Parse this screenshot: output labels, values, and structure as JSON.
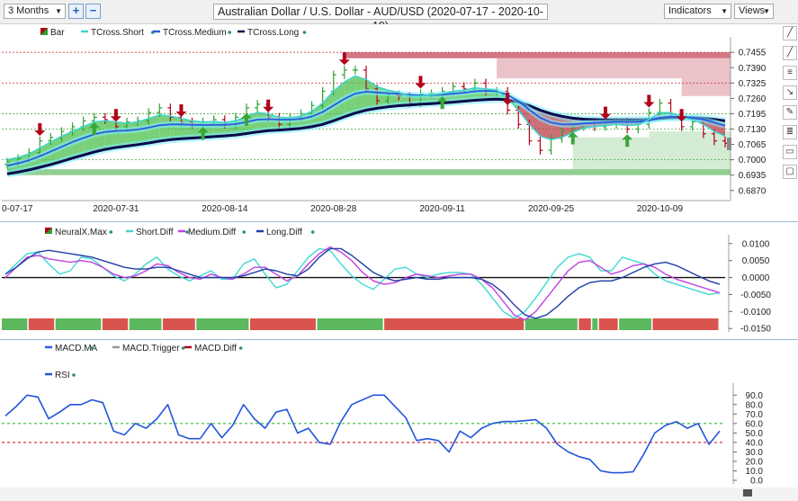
{
  "toolbar": {
    "period": "3 Months",
    "add_label": "+",
    "minus_label": "−",
    "title": "Australian Dollar / U.S. Dollar - AUD/USD (2020-07-17 - 2020-10-19)",
    "indicators_label": "Indicators",
    "views_label": "Views"
  },
  "colors": {
    "bull": "#2da12d",
    "bear": "#b3001b",
    "short": "#3fd6cf",
    "medium": "#2a5be0",
    "long": "#0b0b4a",
    "neural_green": "#5cb85c",
    "neural_red": "#d9534f",
    "magenta": "#c040e0",
    "rsi": "#2255dd"
  },
  "chart_data": [
    {
      "type": "line",
      "panel": "price",
      "legend": [
        "Bar",
        "TCross.Short",
        "TCross.Medium",
        "TCross.Long"
      ],
      "x_ticks": [
        "0-07-17",
        "2020-07-31",
        "2020-08-14",
        "2020-08-28",
        "2020-09-11",
        "2020-09-25",
        "2020-10-09"
      ],
      "y_ticks": [
        "0.7455",
        "0.7390",
        "0.7325",
        "0.7260",
        "0.7195",
        "0.7130",
        "0.7065",
        "0.7000",
        "0.6935",
        "0.6870"
      ],
      "ylim": [
        0.685,
        0.749
      ],
      "dates": [
        "07-17",
        "07-20",
        "07-21",
        "07-22",
        "07-23",
        "07-24",
        "07-27",
        "07-28",
        "07-29",
        "07-30",
        "07-31",
        "08-03",
        "08-04",
        "08-05",
        "08-06",
        "08-07",
        "08-10",
        "08-11",
        "08-12",
        "08-13",
        "08-14",
        "08-17",
        "08-18",
        "08-19",
        "08-20",
        "08-21",
        "08-24",
        "08-25",
        "08-26",
        "08-27",
        "08-28",
        "08-31",
        "09-01",
        "09-02",
        "09-03",
        "09-04",
        "09-07",
        "09-08",
        "09-09",
        "09-10",
        "09-11",
        "09-14",
        "09-15",
        "09-16",
        "09-17",
        "09-18",
        "09-21",
        "09-22",
        "09-23",
        "09-24",
        "09-25",
        "09-28",
        "09-29",
        "09-30",
        "10-01",
        "10-02",
        "10-05",
        "10-06",
        "10-07",
        "10-08",
        "10-09",
        "10-12",
        "10-13",
        "10-14",
        "10-15",
        "10-16",
        "10-19"
      ],
      "close": [
        0.699,
        0.7005,
        0.703,
        0.708,
        0.7095,
        0.712,
        0.714,
        0.7165,
        0.718,
        0.717,
        0.714,
        0.716,
        0.7165,
        0.72,
        0.722,
        0.718,
        0.716,
        0.715,
        0.716,
        0.717,
        0.715,
        0.718,
        0.722,
        0.7235,
        0.718,
        0.715,
        0.718,
        0.7195,
        0.723,
        0.729,
        0.736,
        0.738,
        0.738,
        0.73,
        0.725,
        0.7275,
        0.727,
        0.724,
        0.728,
        0.728,
        0.729,
        0.731,
        0.73,
        0.7325,
        0.729,
        0.729,
        0.721,
        0.715,
        0.708,
        0.704,
        0.709,
        0.712,
        0.714,
        0.716,
        0.714,
        0.715,
        0.716,
        0.713,
        0.715,
        0.72,
        0.724,
        0.719,
        0.714,
        0.716,
        0.711,
        0.708,
        0.707
      ],
      "series": [
        {
          "name": "TCross.Short",
          "values": [
            0.7,
            0.701,
            0.7025,
            0.705,
            0.7075,
            0.71,
            0.712,
            0.714,
            0.716,
            0.7165,
            0.716,
            0.7155,
            0.716,
            0.7175,
            0.719,
            0.7185,
            0.7175,
            0.7165,
            0.716,
            0.7162,
            0.7158,
            0.7165,
            0.7185,
            0.72,
            0.7195,
            0.718,
            0.7178,
            0.7185,
            0.7205,
            0.724,
            0.729,
            0.733,
            0.7355,
            0.734,
            0.731,
            0.7295,
            0.7285,
            0.727,
            0.727,
            0.7275,
            0.728,
            0.729,
            0.7295,
            0.7305,
            0.73,
            0.7295,
            0.726,
            0.721,
            0.715,
            0.71,
            0.7085,
            0.7095,
            0.7115,
            0.7135,
            0.714,
            0.7145,
            0.715,
            0.7145,
            0.7148,
            0.717,
            0.72,
            0.72,
            0.718,
            0.717,
            0.715,
            0.712,
            0.71
          ]
        },
        {
          "name": "TCross.Medium",
          "values": [
            0.6975,
            0.6985,
            0.6998,
            0.7015,
            0.7035,
            0.7055,
            0.7075,
            0.7092,
            0.7108,
            0.7118,
            0.7122,
            0.7124,
            0.7128,
            0.7136,
            0.7146,
            0.715,
            0.715,
            0.7148,
            0.7147,
            0.7148,
            0.7148,
            0.7151,
            0.716,
            0.717,
            0.7172,
            0.717,
            0.717,
            0.7173,
            0.7183,
            0.7202,
            0.723,
            0.7258,
            0.728,
            0.7288,
            0.7285,
            0.7282,
            0.728,
            0.7275,
            0.7273,
            0.7274,
            0.7276,
            0.728,
            0.7284,
            0.729,
            0.7292,
            0.729,
            0.7275,
            0.7248,
            0.7212,
            0.7178,
            0.7158,
            0.715,
            0.715,
            0.7154,
            0.7156,
            0.7158,
            0.716,
            0.716,
            0.716,
            0.7166,
            0.7178,
            0.7183,
            0.718,
            0.7177,
            0.717,
            0.7158,
            0.7145
          ]
        },
        {
          "name": "TCross.Long",
          "values": [
            0.694,
            0.6948,
            0.6957,
            0.6968,
            0.698,
            0.6993,
            0.7007,
            0.702,
            0.7033,
            0.7044,
            0.7052,
            0.7058,
            0.7064,
            0.7071,
            0.7079,
            0.7085,
            0.7089,
            0.7092,
            0.7095,
            0.7098,
            0.7101,
            0.7105,
            0.7111,
            0.7118,
            0.7123,
            0.7126,
            0.7129,
            0.7133,
            0.714,
            0.715,
            0.7165,
            0.7182,
            0.7198,
            0.721,
            0.7218,
            0.7224,
            0.7229,
            0.7232,
            0.7235,
            0.7238,
            0.7241,
            0.7244,
            0.7248,
            0.7252,
            0.7255,
            0.7257,
            0.7254,
            0.7245,
            0.7229,
            0.721,
            0.7195,
            0.7184,
            0.7176,
            0.7172,
            0.717,
            0.7169,
            0.7169,
            0.7169,
            0.7169,
            0.7171,
            0.7175,
            0.7178,
            0.7179,
            0.7178,
            0.7176,
            0.7171,
            0.7165
          ]
        }
      ],
      "down_arrows": [
        3,
        10,
        16,
        24,
        31,
        38,
        46,
        55,
        59,
        62
      ],
      "up_arrows": [
        8,
        18,
        22,
        40,
        52,
        57
      ],
      "zones_red": [
        [
          0.743,
          0.7455,
          31
        ],
        [
          0.7395,
          0.743,
          45
        ],
        [
          0.7345,
          0.7395,
          45
        ],
        [
          0.727,
          0.7345,
          62
        ]
      ],
      "zones_green": [
        [
          0.6935,
          0.696,
          0
        ],
        [
          0.696,
          0.7095,
          52
        ],
        [
          0.7095,
          0.712,
          59
        ]
      ]
    },
    {
      "type": "line",
      "panel": "neural",
      "legend": [
        "NeuralX.Max",
        "Short.Diff",
        "Medium.Diff",
        "Long.Diff"
      ],
      "y_ticks": [
        "0.0100",
        "0.0050",
        "0.0000",
        "-0.0050",
        "-0.0100",
        "-0.0150"
      ],
      "ylim": [
        -0.016,
        0.011
      ],
      "series": [
        {
          "name": "Short.Diff",
          "values": [
            0.001,
            0.004,
            0.007,
            0.0075,
            0.004,
            0.001,
            0.002,
            0.006,
            0.0055,
            0.003,
            0.0005,
            -0.001,
            0.001,
            0.004,
            0.006,
            0.0025,
            0.0005,
            -0.001,
            0.0005,
            0.002,
            -0.0005,
            -0.0005,
            0.004,
            0.0055,
            0.001,
            -0.003,
            -0.002,
            0.002,
            0.006,
            0.0085,
            0.008,
            0.004,
            0.0005,
            -0.002,
            -0.0035,
            -0.0005,
            0.0025,
            0.003,
            0.001,
            0.0,
            0.001,
            0.0015,
            0.0015,
            0.001,
            -0.002,
            -0.006,
            -0.01,
            -0.012,
            -0.01,
            -0.006,
            -0.0015,
            0.003,
            0.006,
            0.007,
            0.006,
            0.002,
            0.002,
            0.006,
            0.005,
            0.004,
            0.001,
            -0.001,
            -0.002,
            -0.003,
            -0.004,
            -0.005,
            -0.0045
          ]
        },
        {
          "name": "Medium.Diff",
          "values": [
            0.0,
            0.003,
            0.006,
            0.0065,
            0.0055,
            0.005,
            0.0045,
            0.005,
            0.0045,
            0.003,
            0.001,
            0.0,
            0.0005,
            0.002,
            0.004,
            0.0035,
            0.0015,
            0.0,
            -0.0005,
            0.001,
            0.0,
            -0.0005,
            0.001,
            0.003,
            0.003,
            0.001,
            -0.001,
            0.0005,
            0.004,
            0.007,
            0.009,
            0.0075,
            0.005,
            0.0015,
            -0.001,
            -0.002,
            -0.0015,
            0.0,
            0.001,
            0.0005,
            0.0,
            0.0005,
            0.001,
            0.001,
            -0.0005,
            -0.003,
            -0.007,
            -0.011,
            -0.0125,
            -0.01,
            -0.006,
            -0.002,
            0.002,
            0.0045,
            0.005,
            0.003,
            0.001,
            0.002,
            0.0035,
            0.004,
            0.003,
            0.001,
            -0.0005,
            -0.0015,
            -0.0025,
            -0.0035,
            -0.0045
          ]
        },
        {
          "name": "Long.Diff",
          "values": [
            0.001,
            0.003,
            0.0055,
            0.0075,
            0.008,
            0.0075,
            0.007,
            0.0065,
            0.006,
            0.005,
            0.004,
            0.003,
            0.0025,
            0.0025,
            0.003,
            0.003,
            0.002,
            0.001,
            0.0,
            0.0,
            0.0,
            0.0,
            0.0005,
            0.0015,
            0.0025,
            0.002,
            0.001,
            0.0005,
            0.0025,
            0.006,
            0.0085,
            0.0085,
            0.0065,
            0.004,
            0.0015,
            0.0,
            -0.001,
            -0.0005,
            0.0,
            -0.0005,
            -0.0005,
            0.0,
            0.0,
            0.0,
            -0.0005,
            -0.002,
            -0.0045,
            -0.008,
            -0.011,
            -0.012,
            -0.011,
            -0.0085,
            -0.0055,
            -0.003,
            -0.0015,
            -0.001,
            -0.001,
            0.0,
            0.0015,
            0.003,
            0.004,
            0.0045,
            0.0035,
            0.002,
            0.0005,
            -0.001,
            -0.002
          ]
        }
      ],
      "neural_segments": [
        [
          "g",
          4
        ],
        [
          "r",
          4
        ],
        [
          "g",
          7
        ],
        [
          "r",
          4
        ],
        [
          "g",
          5
        ],
        [
          "r",
          5
        ],
        [
          "g",
          8
        ],
        [
          "r",
          10
        ],
        [
          "g",
          10
        ],
        [
          "r",
          21
        ],
        [
          "g",
          8
        ],
        [
          "r",
          2
        ],
        [
          "g",
          1
        ],
        [
          "r",
          3
        ],
        [
          "g",
          5
        ],
        [
          "r",
          10
        ]
      ]
    },
    {
      "type": "line",
      "panel": "rsi",
      "legend": [
        "MACD.MA",
        "MACD.Trigger",
        "MACD.Diff"
      ],
      "rsi_label": "RSI",
      "y_ticks": [
        "90.0",
        "80.0",
        "70.0",
        "60.0",
        "50.0",
        "40.0",
        "30.0",
        "20.0",
        "10.0",
        "0.0"
      ],
      "ylim": [
        0,
        95
      ],
      "levels": [
        60,
        40
      ],
      "series": [
        {
          "name": "RSI",
          "values": [
            68,
            78,
            90,
            88,
            65,
            72,
            80,
            80,
            85,
            82,
            52,
            48,
            60,
            55,
            65,
            80,
            48,
            44,
            44,
            60,
            45,
            58,
            80,
            65,
            55,
            72,
            75,
            50,
            55,
            40,
            38,
            62,
            80,
            85,
            90,
            90,
            78,
            66,
            42,
            44,
            42,
            30,
            52,
            45,
            55,
            60,
            62,
            62,
            63,
            64,
            55,
            38,
            30,
            25,
            22,
            10,
            8,
            8,
            9,
            28,
            50,
            58,
            62,
            55,
            60,
            38,
            52
          ]
        }
      ]
    }
  ]
}
